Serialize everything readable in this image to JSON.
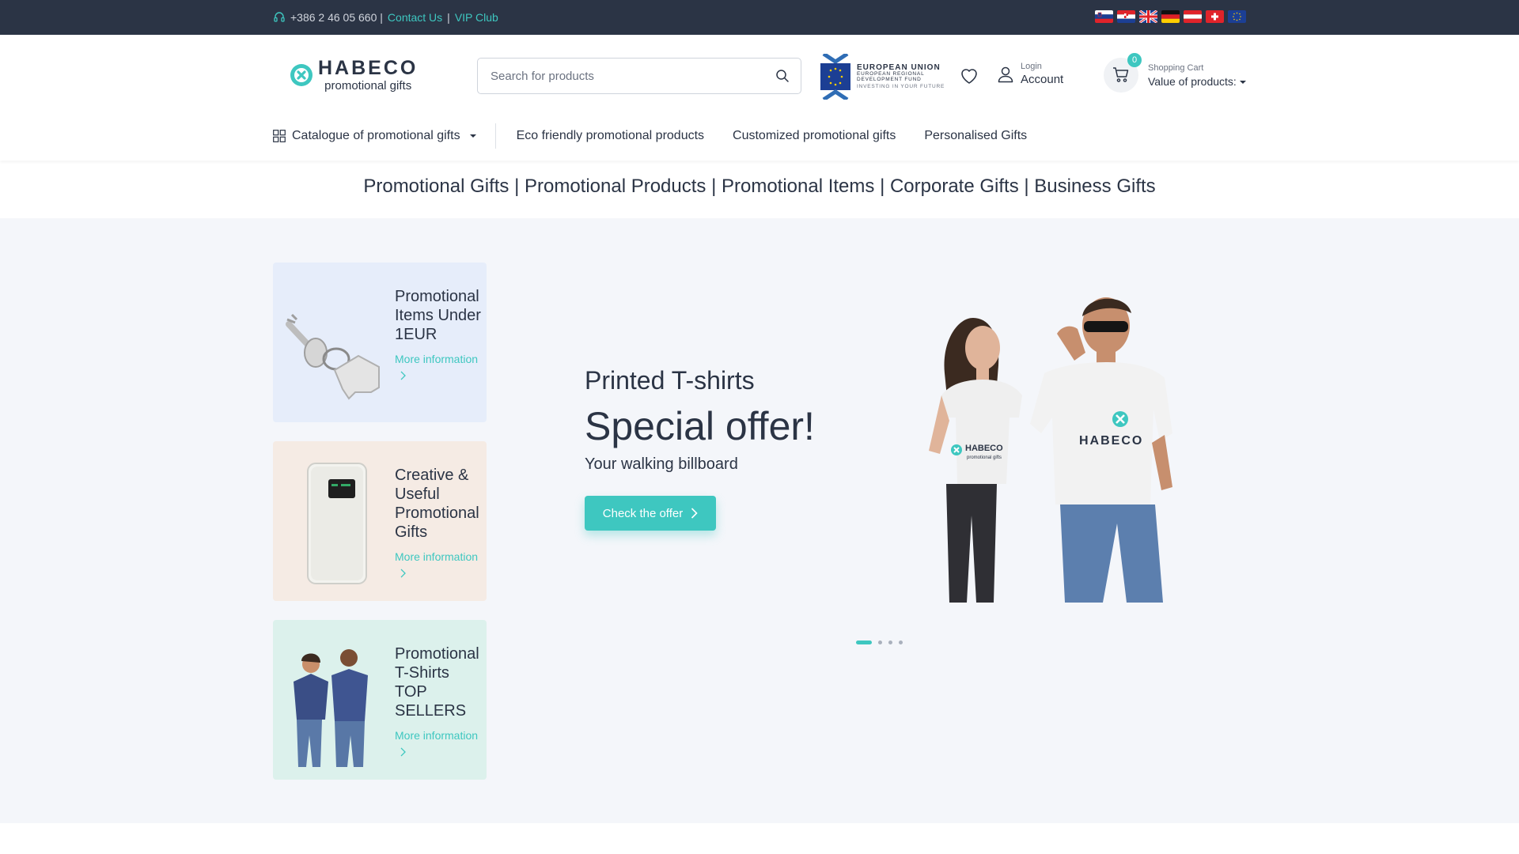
{
  "topbar": {
    "phone": "+386 2 46 05 660 |",
    "contact_label": "Contact Us",
    "separator": "|",
    "vip_label": "VIP Club",
    "flags": [
      "slovenia-flag",
      "croatia-flag",
      "uk-flag",
      "germany-flag",
      "austria-flag",
      "switzerland-flag",
      "eu-flag"
    ]
  },
  "header": {
    "logo_brand": "HABECO",
    "logo_sub": "promotional gifts",
    "search_placeholder": "Search for products",
    "eu_title": "EUROPEAN UNION",
    "eu_sub1": "EUROPEAN REGIONAL",
    "eu_sub2": "DEVELOPMENT FUND",
    "eu_tag": "INVESTING IN YOUR FUTURE",
    "account_small": "Login",
    "account_big": "Account",
    "cart_count": "0",
    "cart_small": "Shopping Cart",
    "cart_big": "Value of products:"
  },
  "nav": {
    "catalogue": "Catalogue of promotional gifts",
    "items": [
      "Eco friendly promotional products",
      "Customized promotional gifts",
      "Personalised Gifts"
    ]
  },
  "tagline": "Promotional Gifts | Promotional Products | Promotional Items | Corporate Gifts | Business Gifts",
  "cards": [
    {
      "title": "Promotional Items Under 1EUR",
      "more": "More information"
    },
    {
      "title": "Creative & Useful Promotional Gifts",
      "more": "More information"
    },
    {
      "title": "Promotional T-Shirts TOP SELLERS",
      "more": "More information"
    }
  ],
  "slide": {
    "kicker": "Printed T-shirts",
    "title": "Special offer!",
    "subtitle": "Your walking billboard",
    "button": "Check the offer",
    "shirt_logo": "HABECO",
    "shirt_logo_sub": "promotional gifts",
    "active_index": 1,
    "total": 4
  },
  "colors": {
    "accent": "#3ec7c0",
    "dark": "#2b3445",
    "hero_bg": "#f4f6fa"
  }
}
